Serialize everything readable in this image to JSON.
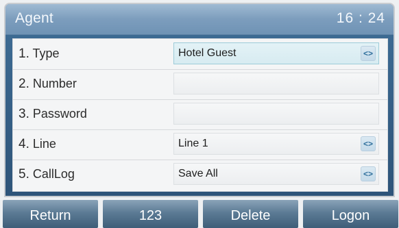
{
  "header": {
    "title": "Agent",
    "time": "16 : 24"
  },
  "rows": [
    {
      "num": "1.",
      "label": "Type",
      "value": "Hotel Guest",
      "has_selector": true,
      "active": true
    },
    {
      "num": "2.",
      "label": "Number",
      "value": "",
      "has_selector": false,
      "active": false
    },
    {
      "num": "3.",
      "label": "Password",
      "value": "",
      "has_selector": false,
      "active": false
    },
    {
      "num": "4.",
      "label": "Line",
      "value": "Line 1",
      "has_selector": true,
      "active": false
    },
    {
      "num": "5.",
      "label": "CallLog",
      "value": "Save All",
      "has_selector": true,
      "active": false
    }
  ],
  "selector_glyph": "<>",
  "softkeys": [
    "Return",
    "123",
    "Delete",
    "Logon"
  ],
  "colors": {
    "titlebar": "#7c9dbd",
    "screen": "#3f6e97",
    "active_field": "#d7ebf1",
    "softkey": "#5c7b95"
  }
}
